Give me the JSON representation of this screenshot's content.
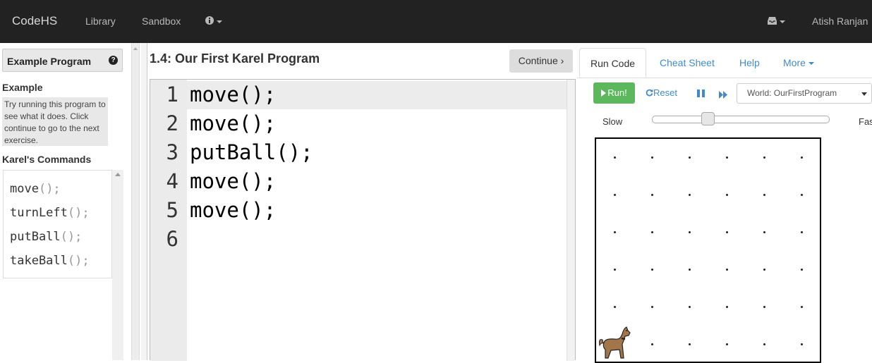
{
  "navbar": {
    "brand": "CodeHS",
    "links": [
      "Library",
      "Sandbox"
    ],
    "info_icon": "info-icon",
    "inbox_icon": "inbox-icon",
    "user_name": "Atish Ranjan"
  },
  "sidebar": {
    "header": "Example Program",
    "help_icon": "question-icon",
    "example_title": "Example",
    "example_desc": "Try running this program to see what it does. Click continue to go to the next exercise.",
    "commands_title": "Karel's Commands",
    "commands": [
      {
        "name": "move",
        "paren": "();"
      },
      {
        "name": "turnLeft",
        "paren": "();"
      },
      {
        "name": "putBall",
        "paren": "();"
      },
      {
        "name": "takeBall",
        "paren": "();"
      }
    ]
  },
  "editor": {
    "title": "1.4: Our First Karel Program",
    "continue_label": "Continue ›",
    "line_numbers": [
      "1",
      "2",
      "3",
      "4",
      "5",
      "6"
    ],
    "lines": [
      "move();",
      "move();",
      "putBall();",
      "move();",
      "move();",
      ""
    ]
  },
  "right_panel": {
    "tabs": [
      "Run Code",
      "Cheat Sheet",
      "Help",
      "More"
    ],
    "active_tab": "Run Code",
    "run_label": "Run!",
    "reset_label": "Reset",
    "world_select": "World: OurFirstProgram",
    "slow_label": "Slow",
    "fast_label": "Fas",
    "speed": 0.3,
    "world": {
      "rows": 6,
      "cols": 6,
      "karel_position": {
        "row": 6,
        "col": 1
      }
    }
  }
}
